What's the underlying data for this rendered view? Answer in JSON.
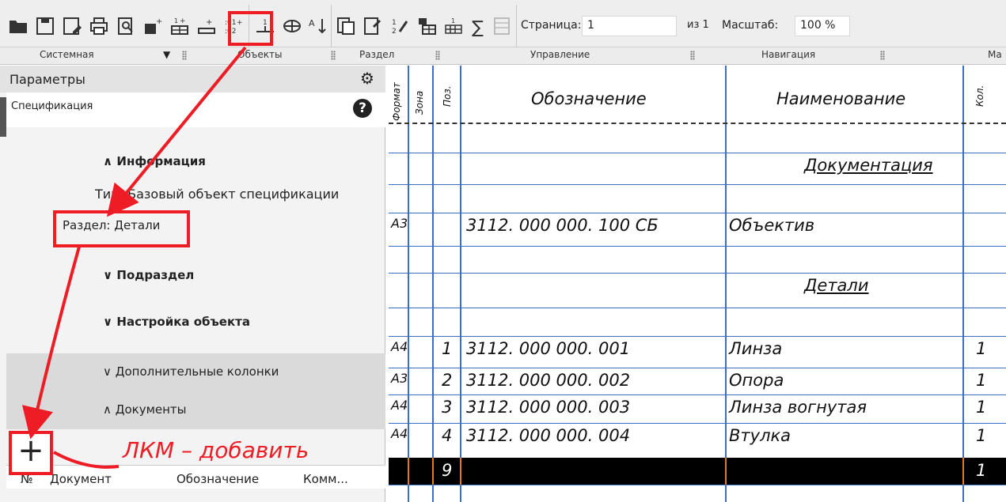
{
  "toolbar": {
    "icons": [
      "open-folder-icon",
      "save-icon",
      "save-as-icon",
      "print-icon",
      "preview-icon",
      "add-object-icon",
      "add-section-icon",
      "add-base-object-icon",
      "renumber-icon",
      "insert-row-icon",
      "layout-icon",
      "sort-icon",
      "copy-icon",
      "object-properties-icon",
      "tools-icon",
      "table-icon",
      "numbering-icon",
      "sum-icon",
      "disabled-icon"
    ],
    "page_label": "Страница:",
    "page_value": "1",
    "page_of": "из 1",
    "scale_label": "Масштаб:",
    "scale_value": "100 %",
    "groups": [
      "Системная",
      "Объекты",
      "Раздел",
      "Управление",
      "Навигация",
      "Ма"
    ]
  },
  "panel": {
    "title": "Параметры",
    "spec_label": "Спецификация",
    "section_info": "∧ Информация",
    "info_type": "Тип: Базовый объект спецификации",
    "info_section": "Раздел: Детали",
    "section_sub": "∨ Подраздел",
    "section_settings": "∨ Настройка объекта",
    "section_extra": "∨ Дополнительные колонки",
    "section_docs": "∧ Документы",
    "doc_cols": [
      "№",
      "Документ",
      "Обозначение",
      "Комм..."
    ]
  },
  "table": {
    "headers": {
      "format": "Формат",
      "zone": "Зона",
      "pos": "Поз.",
      "designation": "Обозначение",
      "name": "Наименование",
      "qty": "Кол."
    },
    "rows": [
      {
        "fmt": "",
        "pos": "",
        "des": "",
        "name": "",
        "qty": ""
      },
      {
        "fmt": "",
        "pos": "",
        "des": "",
        "name": "Документация",
        "qty": "",
        "title": true
      },
      {
        "fmt": "",
        "pos": "",
        "des": "",
        "name": "",
        "qty": ""
      },
      {
        "fmt": "А3",
        "pos": "",
        "des": "3112. 000 000. 100 СБ",
        "name": "Объектив",
        "qty": ""
      },
      {
        "fmt": "",
        "pos": "",
        "des": "",
        "name": "",
        "qty": ""
      },
      {
        "fmt": "",
        "pos": "",
        "des": "",
        "name": "Детали",
        "qty": "",
        "title": true
      },
      {
        "fmt": "",
        "pos": "",
        "des": "",
        "name": "",
        "qty": ""
      },
      {
        "fmt": "А4",
        "pos": "1",
        "des": "3112. 000 000. 001",
        "name": "Линза",
        "qty": "1"
      },
      {
        "fmt": "А3",
        "pos": "2",
        "des": "3112. 000 000. 002",
        "name": "Опора",
        "qty": "1"
      },
      {
        "fmt": "А4",
        "pos": "3",
        "des": "3112. 000 000. 003",
        "name": "Линза вогнутая",
        "qty": "1"
      },
      {
        "fmt": "А4",
        "pos": "4",
        "des": "3112. 000 000. 004",
        "name": "Втулка",
        "qty": "1"
      },
      {
        "fmt": "",
        "pos": "9",
        "des": "",
        "name": "",
        "qty": "1",
        "selected": true
      }
    ]
  },
  "annotation": {
    "label": "ЛКМ – добавить",
    "color": "#ee1c25"
  }
}
